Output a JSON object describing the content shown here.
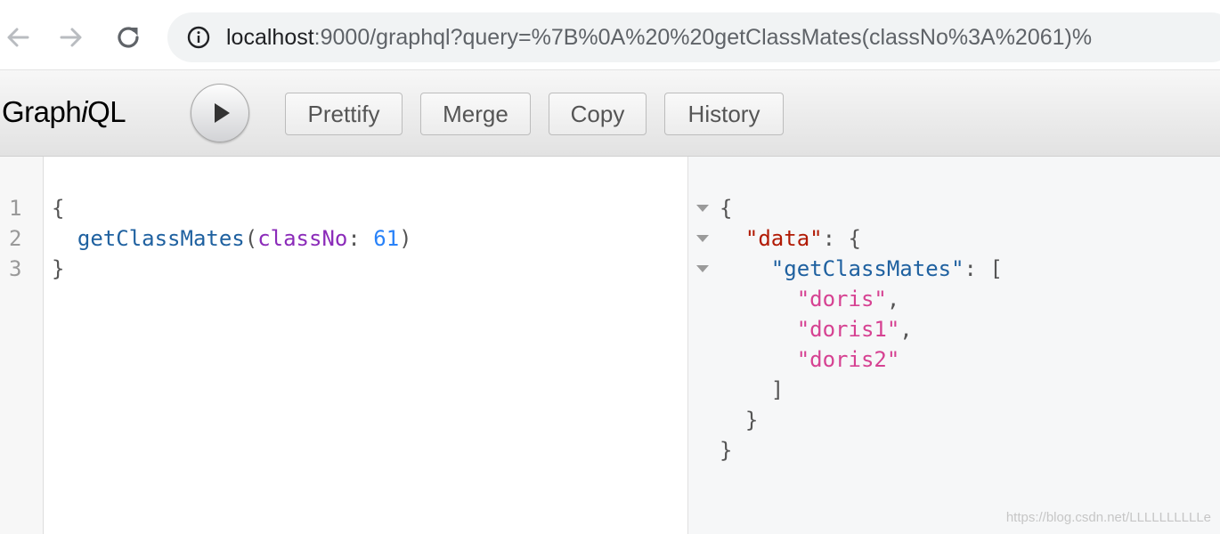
{
  "browser": {
    "url_host": "localhost",
    "url_rest": ":9000/graphql?query=%7B%0A%20%20getClassMates(classNo%3A%2061)%"
  },
  "toolbar": {
    "logo_pre": "Graph",
    "logo_i": "i",
    "logo_post": "QL",
    "prettify_label": "Prettify",
    "merge_label": "Merge",
    "copy_label": "Copy",
    "history_label": "History"
  },
  "query": {
    "line_numbers": [
      "1",
      "2",
      "3"
    ],
    "open_brace": "{",
    "field": "getClassMates",
    "paren_open": "(",
    "arg_name": "classNo",
    "colon": ": ",
    "arg_value": "61",
    "paren_close": ")",
    "close_brace": "}"
  },
  "result": {
    "open_brace": "{",
    "data_key": "\"data\"",
    "data_sep": ": {",
    "field_key": "\"getClassMates\"",
    "field_sep": ": [",
    "items": [
      "\"doris\"",
      "\"doris1\"",
      "\"doris2\""
    ],
    "comma": ",",
    "close_bracket": "]",
    "close_inner": "}",
    "close_outer": "}"
  },
  "watermark": "https://blog.csdn.net/LLLLLLLLLLe"
}
